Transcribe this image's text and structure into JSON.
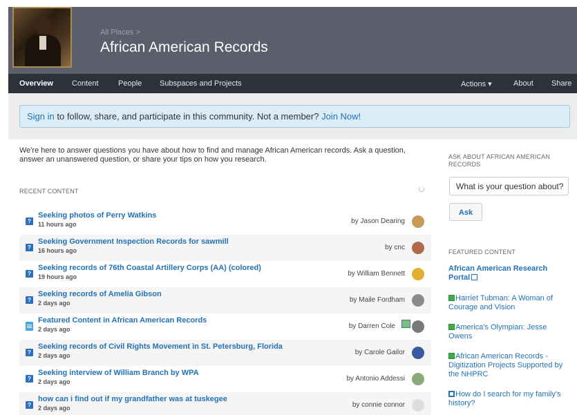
{
  "header": {
    "breadcrumb": "All Places >",
    "title": "African American Records"
  },
  "nav": {
    "overview": "Overview",
    "content": "Content",
    "people": "People",
    "subspaces": "Subspaces and Projects",
    "actions": "Actions ▾",
    "about": "About",
    "share": "Share"
  },
  "banner": {
    "signin": "Sign in",
    "middle": " to follow, share, and participate in this community. Not a member? ",
    "join": "Join Now!"
  },
  "intro": "We're here to answer questions you have about how to find and manage African American records. Ask a question, answer an unanswered question, or share your tips on how you research.",
  "recent": {
    "heading": "RECENT CONTENT",
    "items": [
      {
        "title": "Seeking photos of Perry Watkins",
        "time": "11 hours ago",
        "author": "by Jason Dearing",
        "icon": "question-icon",
        "avatar_color": "#c89a5a"
      },
      {
        "title": "Seeking Government Inspection Records for sawmill",
        "time": "16 hours ago",
        "author": "by cnc",
        "icon": "question-icon",
        "avatar_color": "#b06a4a"
      },
      {
        "title": "Seeking records of 76th Coastal Artillery Corps (AA) (colored)",
        "time": "19 hours ago",
        "author": "by William Bennett",
        "icon": "question-icon",
        "avatar_color": "#e0b030"
      },
      {
        "title": "Seeking records of Amelia Gibson",
        "time": "2 days ago",
        "author": "by Maile Fordham",
        "icon": "question-icon",
        "avatar_color": "#8a8a8a"
      },
      {
        "title": "Featured Content in African American Records",
        "time": "2 days ago",
        "author": "by Darren Cole",
        "icon": "document-icon",
        "avatar_color": "#7a7a7a"
      },
      {
        "title": "Seeking records of Civil Rights Movement in St. Petersburg, Florida",
        "time": "2 days ago",
        "author": "by Carole Gailor",
        "icon": "question-icon",
        "avatar_color": "#3a5aa0"
      },
      {
        "title": "Seeking interview of William Branch by WPA",
        "time": "2 days ago",
        "author": "by Antonio Addessi",
        "icon": "question-icon",
        "avatar_color": "#8aaa7a"
      },
      {
        "title": "how can i find out if my grandfather was at tuskegee",
        "time": "2 days ago",
        "author": "by connie connor",
        "icon": "question-icon",
        "avatar_color": "#dddddd"
      }
    ]
  },
  "sidebar": {
    "ask_heading": "ASK ABOUT AFRICAN AMERICAN RECORDS",
    "ask_placeholder": "What is your question about?",
    "ask_button": "Ask",
    "featured_heading": "FEATURED CONTENT",
    "featured": [
      {
        "label": "African American Research Portal",
        "icon": "external-link-icon"
      },
      {
        "label": "Harriet Tubman: A Woman of Courage and Vision",
        "icon": "document-icon"
      },
      {
        "label": "America's Olympian: Jesse Owens",
        "icon": "document-icon"
      },
      {
        "label": "African American Records - Digitization Projects Supported by the NHPRC",
        "icon": "document-icon"
      },
      {
        "label": "How do I search for my family's history?",
        "icon": "question-icon"
      }
    ]
  },
  "colors": {
    "header_bg": "#5a5f6b",
    "nav_bg": "#2d313a",
    "link": "#2272b6",
    "banner_bg": "#d9ecf8"
  }
}
